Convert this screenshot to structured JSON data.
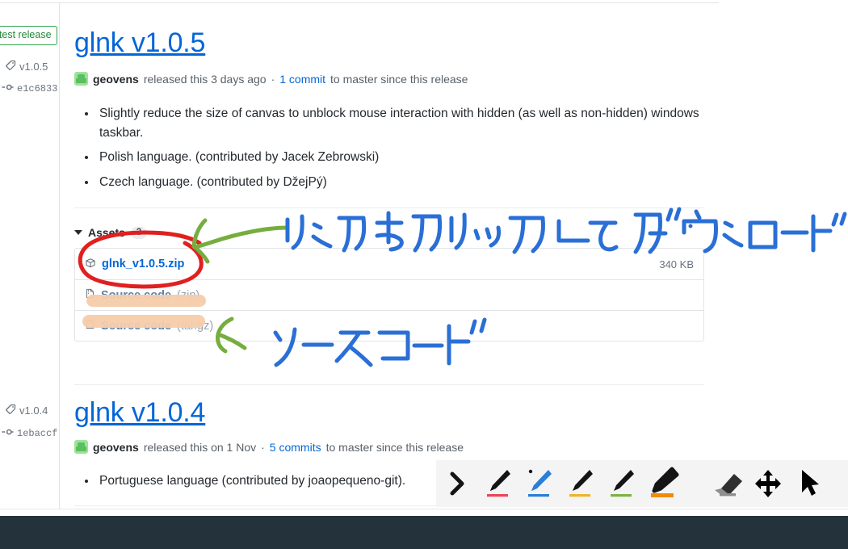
{
  "sidebar": {
    "latest_release_label": "Latest release",
    "entries": [
      {
        "tag": "v1.0.5",
        "commit": "e1c6833"
      },
      {
        "tag": "v1.0.4",
        "commit": "1ebaccf"
      }
    ],
    "tag_icon": "tag-icon",
    "commit_icon": "commit-icon"
  },
  "releases": [
    {
      "title": "glnk v1.0.5",
      "author": "geovens",
      "released_text": "released this 3 days ago",
      "separator": "·",
      "commit_link": "1 commit",
      "commit_suffix": "to master since this release",
      "notes": [
        "Slightly reduce the size of canvas to unblock mouse interaction with hidden (as well as non-hidden) windows taskbar.",
        "Polish language. (contributed by Jacek Zebrowski)",
        "Czech language. (contributed by DžejPý)"
      ]
    },
    {
      "title": "glnk v1.0.4",
      "author": "geovens",
      "released_text": "released this on 1 Nov",
      "separator": "·",
      "commit_link": "5 commits",
      "commit_suffix": "to master since this release",
      "notes": [
        "Portuguese language (contributed by joaopequeno-git)."
      ]
    }
  ],
  "assets": {
    "heading": "Assets",
    "count": "3",
    "caret_icon": "caret-down-icon",
    "rows": [
      {
        "icon": "package-icon",
        "label": "glnk_v1.0.5.zip",
        "suffix": "",
        "size": "340 KB"
      },
      {
        "icon": "file-zip-icon",
        "label": "Source code",
        "suffix": " (zip)",
        "size": ""
      },
      {
        "icon": "file-zip-icon",
        "label": "Source code",
        "suffix": " (tar.gz)",
        "size": ""
      }
    ]
  },
  "annotations": [
    {
      "name": "download-instruction",
      "text": "リンクをクリックしてダウンロード",
      "color": "#2a6fd6"
    },
    {
      "name": "source-code-label",
      "text": "ソースコード",
      "color": "#2a6fd6"
    }
  ],
  "ink_colors": {
    "blue_pen": "#2a6fd6",
    "green_arrow": "#76ad3f",
    "red_circle": "#e02020",
    "orange_highlight": "#f6ccaa"
  },
  "toolbar": {
    "tools": [
      {
        "name": "collapse-toolbar-button",
        "icon": "chevron-right-icon",
        "color": "#1b1b1b"
      },
      {
        "name": "pen-red-button",
        "icon": "pen-icon",
        "color": "#e8475a"
      },
      {
        "name": "pen-blue-button",
        "icon": "pen-icon",
        "color": "#2a7fd6"
      },
      {
        "name": "pen-yellow-button",
        "icon": "pen-icon",
        "color": "#f0b42b"
      },
      {
        "name": "pen-green-button",
        "icon": "pen-icon",
        "color": "#7cb342"
      },
      {
        "name": "highlighter-orange-button",
        "icon": "highlighter-icon",
        "color": "#f28b00"
      },
      {
        "name": "eraser-button",
        "icon": "eraser-icon",
        "color": "#2f2f2f"
      },
      {
        "name": "move-button",
        "icon": "move-arrows-icon",
        "color": "#000000"
      },
      {
        "name": "select-button",
        "icon": "cursor-arrow-icon",
        "color": "#000000"
      }
    ],
    "active_tool": "pen-blue-button",
    "background": "#f4f4f4"
  },
  "bottom_bar": {
    "color": "#24333b"
  }
}
